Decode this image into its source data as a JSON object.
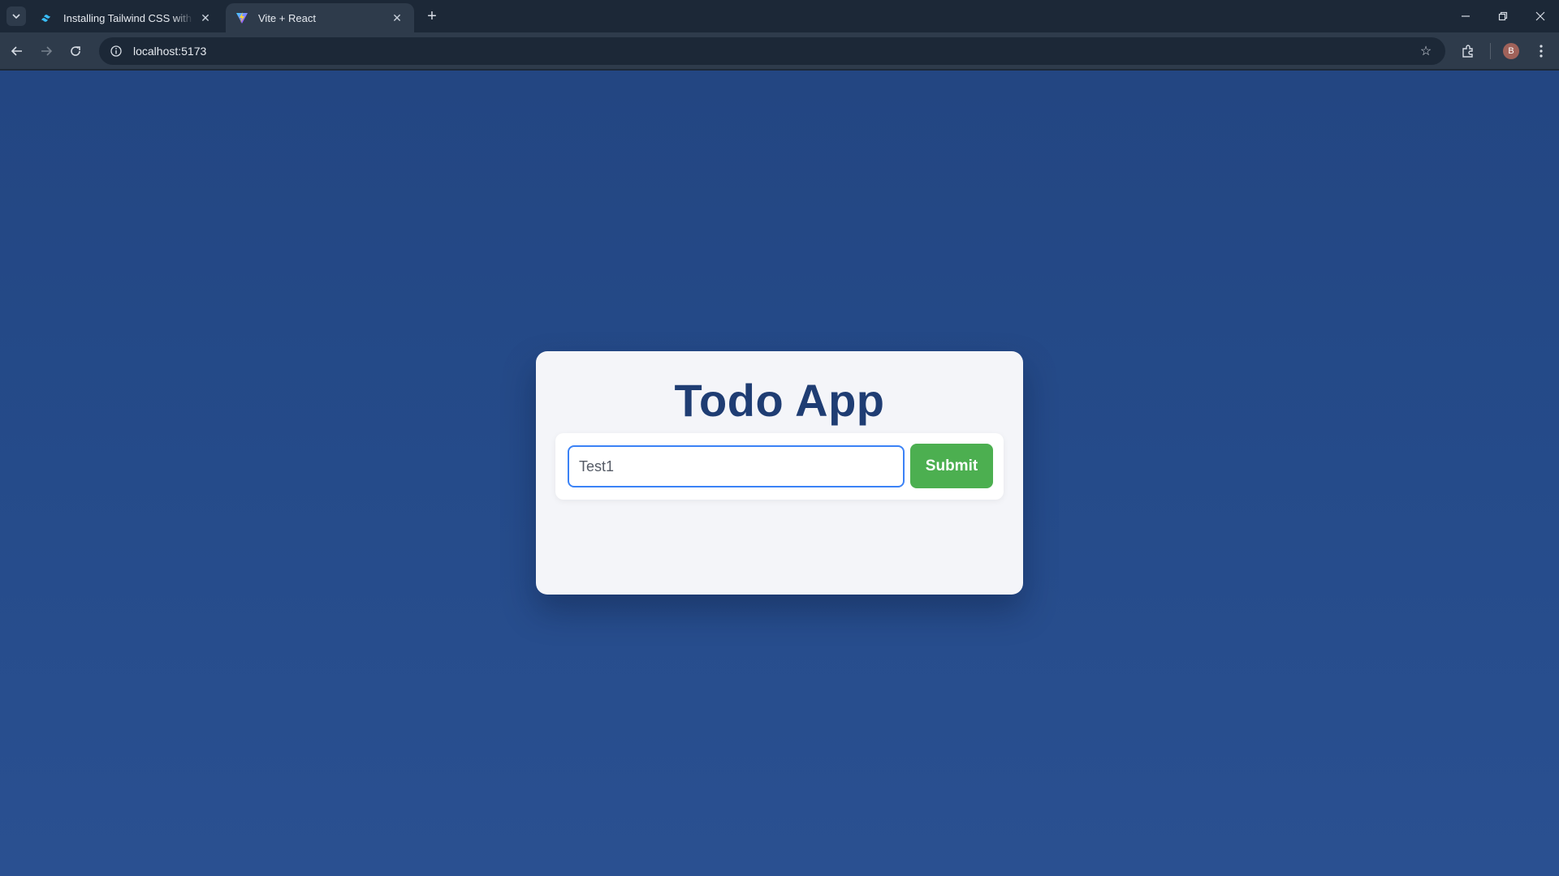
{
  "browser": {
    "tabs": [
      {
        "title": "Installing Tailwind CSS with Vite",
        "active": false,
        "icon": "tailwind-icon"
      },
      {
        "title": "Vite + React",
        "active": true,
        "icon": "vite-icon"
      }
    ],
    "address": "localhost:5173",
    "profile_initial": "B"
  },
  "app": {
    "title": "Todo App",
    "input_value": "Test1",
    "submit_label": "Submit"
  },
  "colors": {
    "background": "#254b8a",
    "card": "#f4f5f9",
    "title": "#1f3d73",
    "submit": "#4caf50",
    "input_focus": "#3b82f6"
  }
}
